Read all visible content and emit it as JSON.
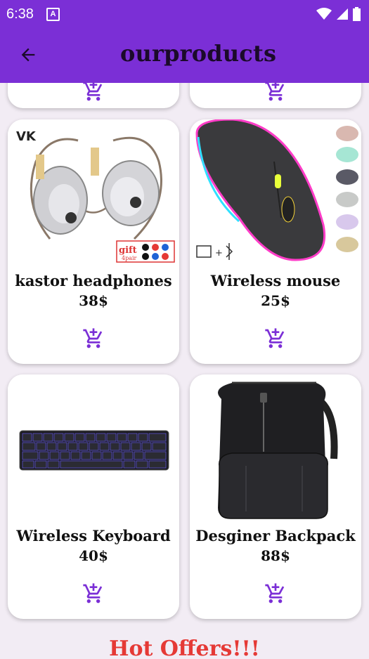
{
  "status_bar": {
    "time": "6:38",
    "notification_letter": "A"
  },
  "app_bar": {
    "title": "ourproducts"
  },
  "products": [
    {
      "name": "kastor headphones",
      "price": "38$"
    },
    {
      "name": "Wireless mouse",
      "price": "25$"
    },
    {
      "name": "Wireless Keyboard",
      "price": "40$"
    },
    {
      "name": "Desginer Backpack",
      "price": "88$"
    }
  ],
  "headphones_badge": {
    "gift": "gift",
    "pair": "4pair"
  },
  "section": {
    "hot_offers": "Hot Offers!!!"
  },
  "colors": {
    "primary": "#7b2fd6",
    "accent_red": "#e53935",
    "background": "#f2ecf4"
  }
}
